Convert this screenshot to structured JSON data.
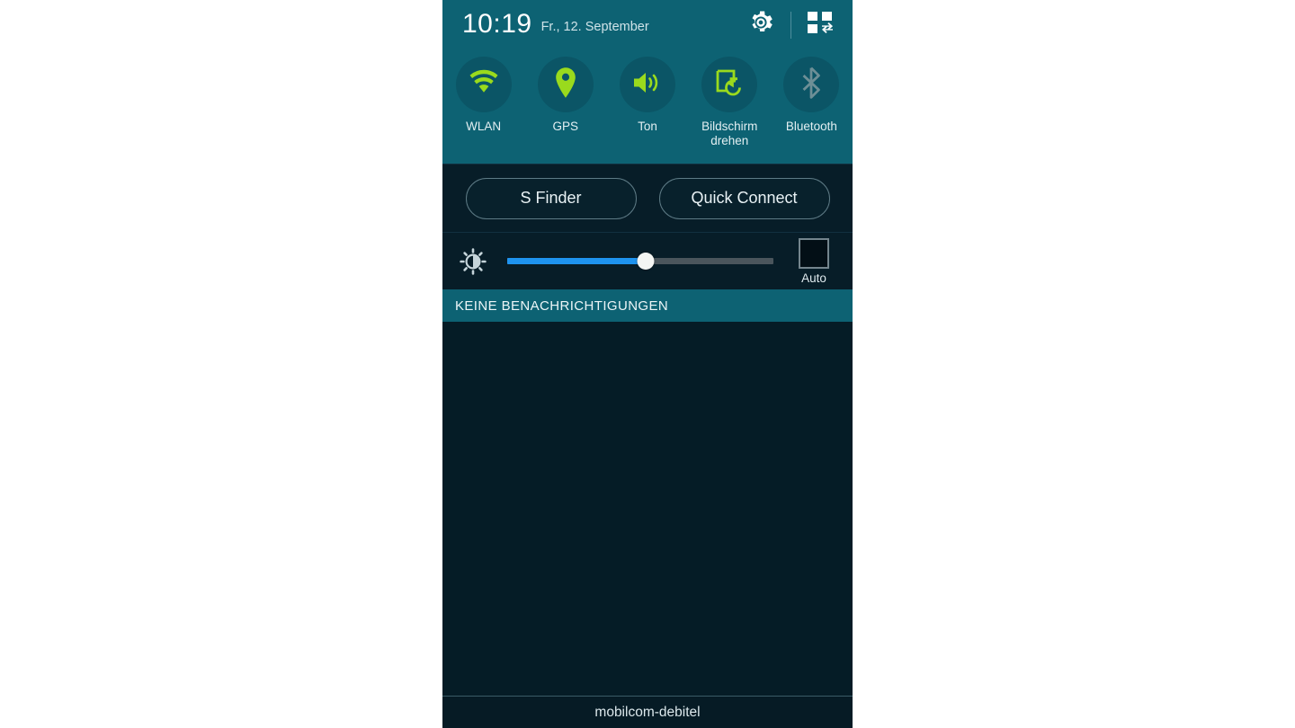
{
  "statusbar": {
    "time": "10:19",
    "date": "Fr., 12. September",
    "settings_icon": "gear-icon",
    "edit_toggles_icon": "quick-settings-edit-icon"
  },
  "toggles": [
    {
      "label": "WLAN",
      "icon": "wifi-icon",
      "state": "on",
      "color": "#9ada1d"
    },
    {
      "label": "GPS",
      "icon": "location-pin-icon",
      "state": "on",
      "color": "#9ada1d"
    },
    {
      "label": "Ton",
      "icon": "sound-speaker-icon",
      "state": "on",
      "color": "#9ada1d"
    },
    {
      "label": "Bildschirm drehen",
      "icon": "screen-rotate-icon",
      "state": "on",
      "color": "#9ada1d"
    },
    {
      "label": "Bluetooth",
      "icon": "bluetooth-icon",
      "state": "off",
      "color": "#6d8f96"
    }
  ],
  "shortcuts": {
    "s_finder_label": "S Finder",
    "quick_connect_label": "Quick Connect"
  },
  "brightness": {
    "icon": "brightness-icon",
    "value_percent": 52,
    "fill_color": "#1e93ef",
    "track_color": "#4a555c",
    "auto_label": "Auto",
    "auto_checked": false
  },
  "notifications": {
    "header": "KEINE BENACHRICHTIGUNGEN",
    "items": []
  },
  "carrier": {
    "name": "mobilcom-debitel"
  },
  "theme": {
    "teal": "#0d6273",
    "dark_navy": "#071d28",
    "notif_bg": "#051c26",
    "accent_green": "#9ada1d",
    "inactive_gray": "#6d8f96"
  }
}
